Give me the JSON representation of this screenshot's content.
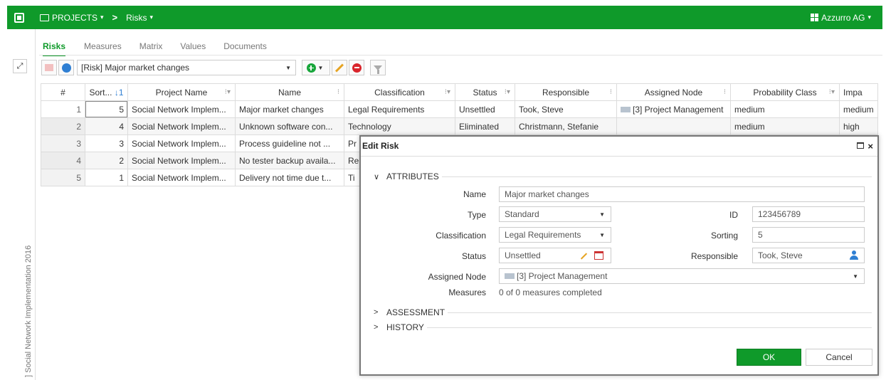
{
  "topbar": {
    "projects_label": "PROJECTS",
    "breadcrumb_sep": ">",
    "current": "Risks",
    "organization": "Azzurro AG",
    "bg_color": "#0f9a2a"
  },
  "sidebar": {
    "vertical_label": "] Social Network Implementation 2016"
  },
  "tabs": [
    {
      "label": "Risks",
      "active": true
    },
    {
      "label": "Measures"
    },
    {
      "label": "Matrix"
    },
    {
      "label": "Values"
    },
    {
      "label": "Documents"
    }
  ],
  "toolbar": {
    "risk_select_value": "[Risk] Major market changes"
  },
  "table": {
    "headers": [
      "#",
      "Sort...",
      "Project Name",
      "Name",
      "Classification",
      "Status",
      "Responsible",
      "Assigned Node",
      "Probability Class",
      "Impa"
    ],
    "sort_indicator": "↓1",
    "rows": [
      [
        "1",
        "5",
        "Social Network Implem...",
        "Major market changes",
        "Legal Requirements",
        "Unsettled",
        "Took, Steve",
        "[3] Project Management",
        "medium",
        "medium"
      ],
      [
        "2",
        "4",
        "Social Network Implem...",
        "Unknown software con...",
        "Technology",
        "Eliminated",
        "Christmann, Stefanie",
        "",
        "medium",
        "high"
      ],
      [
        "3",
        "3",
        "Social Network Implem...",
        "Process guideline not ...",
        "Pr",
        "",
        "",
        "",
        "",
        ""
      ],
      [
        "4",
        "2",
        "Social Network Implem...",
        "No tester backup availa...",
        "Re",
        "",
        "",
        "",
        "",
        ""
      ],
      [
        "5",
        "1",
        "Social Network Implem...",
        "Delivery not time due t...",
        "Ti",
        "",
        "",
        "",
        "",
        ""
      ]
    ]
  },
  "dialog": {
    "title": "Edit Risk",
    "close": "×",
    "sections": {
      "attributes": "ATTRIBUTES",
      "assessment": "ASSESSMENT",
      "history": "HISTORY"
    },
    "fields": {
      "name_label": "Name",
      "name_value": "Major market changes",
      "type_label": "Type",
      "type_value": "Standard",
      "id_label": "ID",
      "id_value": "123456789",
      "classification_label": "Classification",
      "classification_value": "Legal Requirements",
      "sorting_label": "Sorting",
      "sorting_value": "5",
      "status_label": "Status",
      "status_value": "Unsettled",
      "responsible_label": "Responsible",
      "responsible_value": "Took, Steve",
      "node_label": "Assigned Node",
      "node_value": "[3] Project Management",
      "measures_label": "Measures",
      "measures_value": "0 of 0 measures completed"
    },
    "ok_label": "OK",
    "cancel_label": "Cancel"
  }
}
